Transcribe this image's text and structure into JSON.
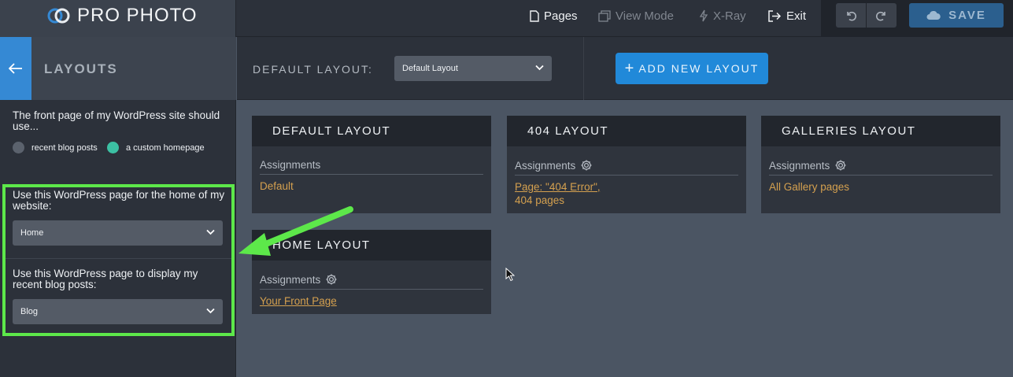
{
  "app": {
    "logo_text": "PRO PHOTO"
  },
  "topnav": {
    "pages": "Pages",
    "view_mode": "View Mode",
    "xray": "X-Ray",
    "exit": "Exit",
    "save": "SAVE"
  },
  "sidebar": {
    "title": "LAYOUTS",
    "question": "The front page of my WordPress site should use...",
    "radio_recent": "recent blog posts",
    "radio_custom": "a custom homepage",
    "radio_selected": "a custom homepage",
    "home_label": "Use this WordPress page for the home of my website:",
    "home_value": "Home",
    "blog_label": "Use this WordPress page to display my recent blog posts:",
    "blog_value": "Blog"
  },
  "layout_header": {
    "default_label": "DEFAULT LAYOUT:",
    "default_value": "Default Layout",
    "add_button": "ADD NEW LAYOUT"
  },
  "cards": [
    {
      "title": "DEFAULT LAYOUT",
      "assignments_label": "Assignments",
      "assignment": "Default"
    },
    {
      "title": "404 LAYOUT",
      "assignments_label": "Assignments",
      "assignment_line1": "Page: \"404 Error\",",
      "assignment_line2": "404 pages"
    },
    {
      "title": "GALLERIES LAYOUT",
      "assignments_label": "Assignments",
      "assignment": "All Gallery pages"
    },
    {
      "title": "HOME LAYOUT",
      "assignments_label": "Assignments",
      "assignment": "Your Front Page"
    }
  ],
  "colors": {
    "accent_blue": "#2189d9",
    "highlight_green": "#5de84a",
    "radio_selected": "#3cc0a3",
    "assignment_link": "#d4a04f"
  }
}
